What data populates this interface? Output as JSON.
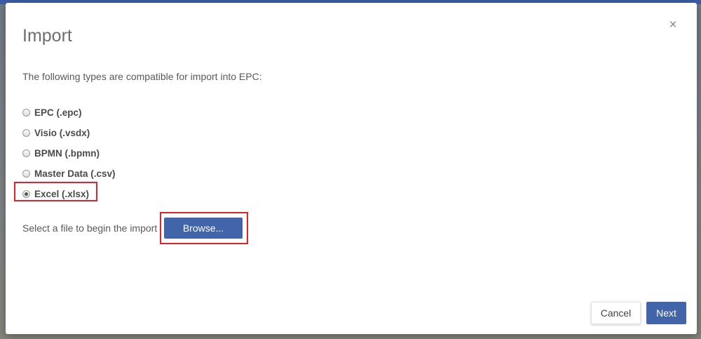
{
  "dialog": {
    "title": "Import",
    "close_symbol": "×",
    "intro": "The following types are compatible for import into EPC:",
    "options": [
      {
        "label": "EPC (.epc)",
        "selected": false
      },
      {
        "label": "Visio (.vsdx)",
        "selected": false
      },
      {
        "label": "BPMN (.bpmn)",
        "selected": false
      },
      {
        "label": "Master Data (.csv)",
        "selected": false
      },
      {
        "label": "Excel (.xlsx)",
        "selected": true
      }
    ],
    "select_prompt": "Select a file to begin the import",
    "browse_label": "Browse...",
    "cancel_label": "Cancel",
    "next_label": "Next"
  },
  "icons": {
    "close": "close-icon"
  },
  "colors": {
    "primary_button": "#4264a9",
    "highlight": "#e0232b"
  }
}
